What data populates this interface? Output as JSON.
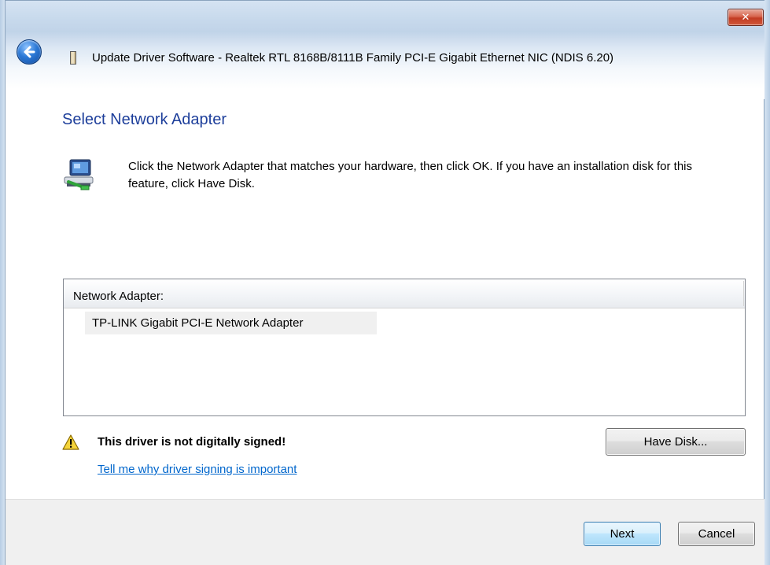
{
  "window": {
    "title": "Update Driver Software -  Realtek RTL 8168B/8111B Family PCI-E Gigabit Ethernet NIC (NDIS 6.20)",
    "close_label": "✕"
  },
  "page": {
    "heading": "Select Network Adapter",
    "instructions": "Click the Network Adapter that matches your hardware, then click OK. If you have an installation disk for this feature, click Have Disk."
  },
  "list": {
    "header": "Network Adapter:",
    "items": [
      "TP-LINK Gigabit PCI-E Network Adapter"
    ]
  },
  "warning": {
    "text": "This driver is not digitally signed!",
    "link": "Tell me why driver signing is important"
  },
  "buttons": {
    "have_disk": "Have Disk...",
    "next": "Next",
    "cancel": "Cancel"
  },
  "icons": {
    "back": "back-arrow-icon",
    "nic": "network-card-icon",
    "adapter": "network-adapter-icon",
    "warning": "warning-triangle-icon"
  },
  "colors": {
    "heading": "#1e3f9b",
    "link": "#0066cc",
    "close_button": "#c23c23"
  }
}
